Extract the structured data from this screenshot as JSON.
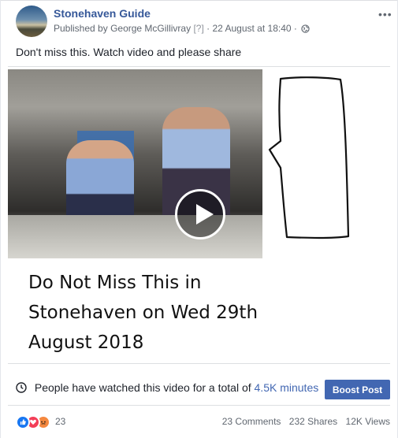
{
  "post": {
    "page_name": "Stonehaven Guide",
    "published_prefix": "Published by",
    "author": "George McGillivray",
    "help_marker": "[?]",
    "separator": "·",
    "timestamp": "22 August at 18:40",
    "privacy_icon": "globe-icon",
    "more_icon": "•••",
    "caption": "Don't miss this. Watch video and please share"
  },
  "media": {
    "play_icon": "play-icon",
    "overlay_lines": [
      "Do Not Miss This in",
      "Stonehaven on Wed 29th",
      "August 2018"
    ]
  },
  "stats": {
    "prefix": "People have watched this video for a total of",
    "minutes": "4.5K minutes",
    "boost_label": "Boost Post",
    "clock_icon": "clock-icon"
  },
  "engagement": {
    "reaction_icons": [
      "like",
      "love",
      "angry"
    ],
    "reaction_count": "23",
    "comments": "23 Comments",
    "shares": "232 Shares",
    "views": "12K Views"
  },
  "colors": {
    "link": "#365899",
    "accent": "#4267b2",
    "like": "#1877f2",
    "love": "#f33e58",
    "angry": "#f5883f"
  }
}
